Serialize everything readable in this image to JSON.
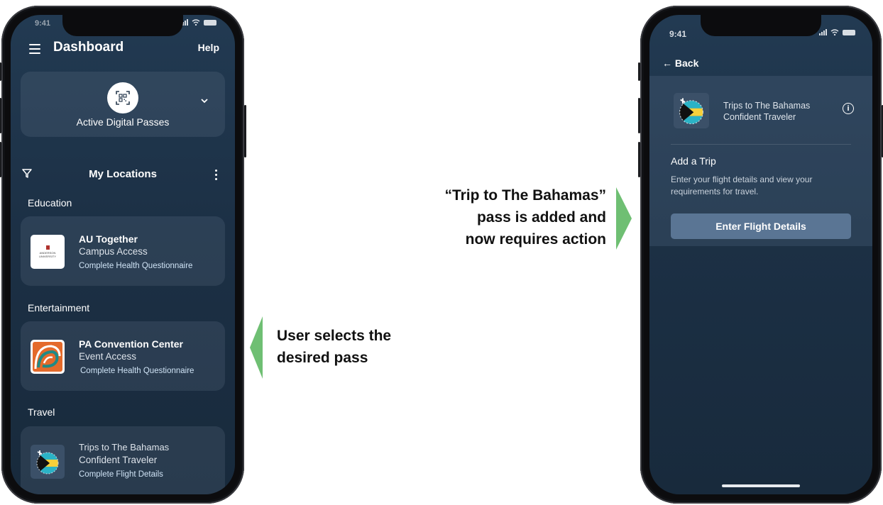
{
  "left_phone": {
    "status_time": "9:41",
    "header": {
      "title": "Dashboard",
      "help": "Help"
    },
    "passes_card": {
      "label": "Active Digital Passes",
      "icons": {
        "qr": "qr-code-icon",
        "expand": "chevron-down-icon"
      }
    },
    "locations": {
      "title": "My Locations",
      "icons": {
        "filter": "filter-icon",
        "more": "more-vertical-icon"
      }
    },
    "sections": [
      {
        "name": "Education",
        "item": {
          "title": "AU Together",
          "subtitle": "Campus Access",
          "action": "Complete Health Questionnaire",
          "logo_text": "ANDERSON UNIVERSITY"
        }
      },
      {
        "name": "Entertainment",
        "item": {
          "title": "PA Convention Center",
          "subtitle": "Event Access",
          "action": "Complete Health Questionnaire"
        }
      },
      {
        "name": "Travel",
        "item": {
          "title": "Trips to The Bahamas",
          "subtitle": "Confident Traveler",
          "action": "Complete Flight Details"
        }
      }
    ]
  },
  "right_phone": {
    "status_time": "9:41",
    "back": "Back",
    "pass_name_line1": "Trips to The Bahamas",
    "pass_name_line2": "Confident Traveler",
    "add_trip_title": "Add a Trip",
    "add_trip_desc": "Enter your flight details and view your requirements for travel.",
    "button_label": "Enter Flight Details"
  },
  "callouts": {
    "left": [
      "User selects the",
      "desired pass"
    ],
    "right": [
      "“Trip to The Bahamas”",
      "pass is added and",
      "now requires action"
    ]
  },
  "colors": {
    "screen_bg": "#1c3045",
    "card_bg": "#2e455c",
    "button_bg": "#5a7594",
    "arrow_green": "#6fbf73",
    "bahamas_aqua": "#2bb3c6",
    "bahamas_gold": "#f7d03a"
  }
}
